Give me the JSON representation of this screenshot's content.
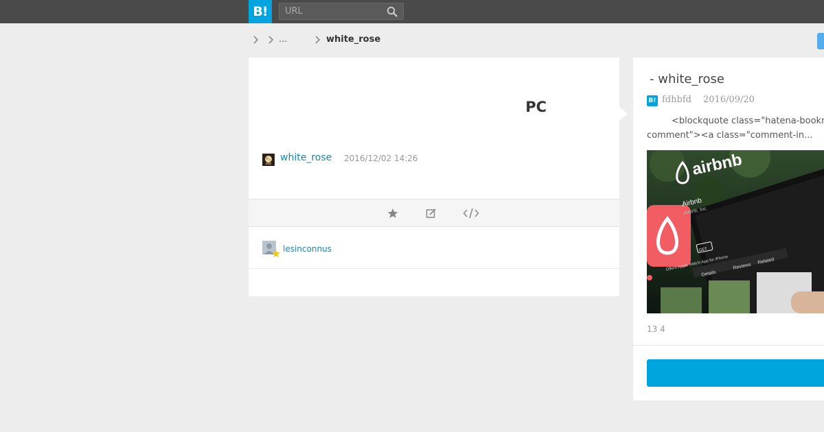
{
  "header": {
    "logo_text": "B!",
    "search_placeholder": "URL",
    "brand_color": "#00a4de"
  },
  "breadcrumb": {
    "ellipsis": "...",
    "current": "white_rose"
  },
  "entry": {
    "title": "PC",
    "user": "white_rose",
    "timestamp": "2016/12/02 14:26"
  },
  "actions": {
    "icons": [
      "star-icon",
      "edit-icon",
      "embed-code-icon"
    ]
  },
  "stars": {
    "users": [
      "lesinconnus"
    ]
  },
  "side": {
    "title": "- white_rose",
    "badge": "B!",
    "user": "fdhbfd",
    "date": "2016/09/20",
    "quote": "<blockquote class=\"hatena-bookm comment\"><a class=\"comment-in...",
    "image_text": "airbnb",
    "image_app_name": "Airbnb",
    "image_company": "Airbnb, Inc.",
    "image_get": "GET",
    "image_offers": "Offers Apple Watch App for iPhone",
    "image_tabs": [
      "Details",
      "Reviews",
      "Related"
    ],
    "counts": "13 4"
  }
}
